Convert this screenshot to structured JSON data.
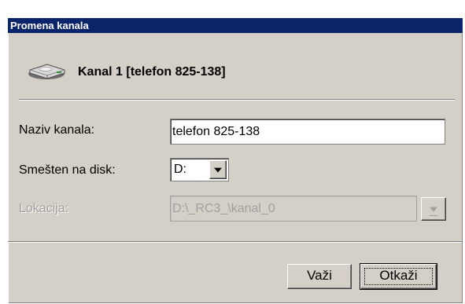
{
  "window": {
    "title": "Promena kanala"
  },
  "header": {
    "icon": "drive-icon",
    "title": "Kanal 1 [telefon 825-138]"
  },
  "form": {
    "name_label": "Naziv kanala:",
    "name_value": "telefon 825-138",
    "disk_label": "Smešten na disk:",
    "disk_value": "D:",
    "location_label": "Lokacija:",
    "location_value": "D:\\_RC3_\\kanal_0"
  },
  "buttons": {
    "ok_label": "Važi",
    "cancel_label": "Otkaži"
  },
  "colors": {
    "dialog_background": "#d4d0c8",
    "titlebar": "#0a246a",
    "disabled_text": "#a0a0a0"
  }
}
